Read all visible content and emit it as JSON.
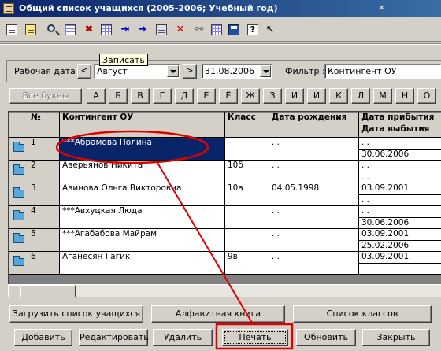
{
  "window": {
    "title": "Общий список учащихся (2005-2006; Учебный год)",
    "close_glyph": "×"
  },
  "toolbar": {
    "icons": [
      "document-icon",
      "edit-icon",
      "search-icon",
      "grid-icon",
      "delete-icon",
      "grid-icon",
      "move-icon",
      "arrow-icon",
      "copy-icon",
      "cross-icon",
      "link-icon",
      "grid-icon",
      "save-icon",
      "help-icon",
      "pointer-icon"
    ]
  },
  "tooltip": {
    "text": "Записать"
  },
  "filters": {
    "date_label": "Рабочая дата :",
    "prev_glyph": "<",
    "month_value": "Август",
    "next_glyph": ">",
    "date_value": "31.08.2006",
    "filter_label": "Фильтр :",
    "filter_value": "Контингент ОУ"
  },
  "alphabet": {
    "all_label": "Все буквы",
    "letters": [
      "А",
      "Б",
      "В",
      "Г",
      "Д",
      "Е",
      "Ё",
      "Ж",
      "З",
      "И",
      "Й",
      "К",
      "Л",
      "М",
      "Н",
      "О"
    ]
  },
  "table": {
    "headers": {
      "num": "№",
      "name": "Контингент ОУ",
      "class": "Класс",
      "birth": "Дата рождения",
      "arrival": "Дата прибытия",
      "departure": "Дата выбытия"
    },
    "rows": [
      {
        "num": "1",
        "name": "***Абрамова Полина",
        "class": "",
        "birth": " .  .",
        "arrival": " .  .",
        "departure": "30.06.2006"
      },
      {
        "num": "2",
        "name": "Аверьянов Никита",
        "class": "10б",
        "birth": " .  .",
        "arrival": " .  .",
        "departure": " .  ."
      },
      {
        "num": "3",
        "name": "Авинова Ольга Викторовна",
        "class": "10а",
        "birth": "04.05.1998",
        "arrival": "03.09.2001",
        "departure": " .  ."
      },
      {
        "num": "4",
        "name": "***Авхуцкая Люда",
        "class": "",
        "birth": " .  .",
        "arrival": " .  .",
        "departure": "30.06.2006"
      },
      {
        "num": "5",
        "name": "***Агабабова Майрам",
        "class": "",
        "birth": " .  .",
        "arrival": "03.09.2001",
        "departure": "25.02.2006"
      },
      {
        "num": "6",
        "name": "Аганесян Гагик",
        "class": "9в",
        "birth": " .  .",
        "arrival": "03.09.2001",
        "departure": ""
      }
    ]
  },
  "buttons_row1": {
    "load": "Загрузить список учащихся",
    "alpha_book": "Алфавитная книга",
    "class_list": "Список классов"
  },
  "buttons_row2": {
    "add": "Добавить",
    "edit": "Редактировать",
    "delete": "Удалить",
    "print": "Печать",
    "refresh": "Обновить",
    "close": "Закрыть"
  },
  "colors": {
    "title_bar": "#0a246a",
    "selection": "#0a246a",
    "annotation": "#e00000",
    "window_face": "#d4d0c8"
  }
}
